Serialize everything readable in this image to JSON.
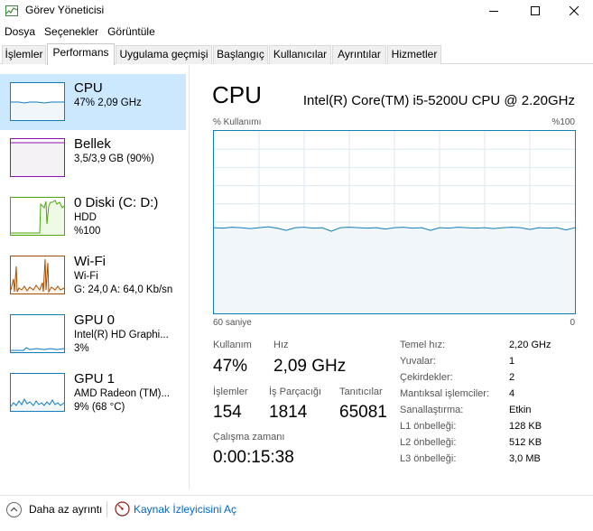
{
  "window": {
    "title": "Görev Yöneticisi",
    "minimize_icon": "minimize-icon",
    "maximize_icon": "maximize-icon",
    "close_icon": "close-icon"
  },
  "menu": [
    "Dosya",
    "Seçenekler",
    "Görüntüle"
  ],
  "tabs": [
    "İşlemler",
    "Performans",
    "Uygulama geçmişi",
    "Başlangıç",
    "Kullanıcılar",
    "Ayrıntılar",
    "Hizmetler"
  ],
  "active_tab": "Performans",
  "sidebar": [
    {
      "title": "CPU",
      "line2": "47% 2,09 GHz",
      "line3": "",
      "selected": true,
      "color": "#117dbb"
    },
    {
      "title": "Bellek",
      "line2": "3,5/3,9 GB (90%)",
      "line3": "",
      "selected": false,
      "color": "#8b12ae"
    },
    {
      "title": "0 Diski (C: D:)",
      "line2": "HDD",
      "line3": "%100",
      "selected": false,
      "color": "#4da60c"
    },
    {
      "title": "Wi-Fi",
      "line2": "Wi-Fi",
      "line3": "G: 24,0  A: 64,0 Kb/sn",
      "selected": false,
      "color": "#a74f01"
    },
    {
      "title": "GPU 0",
      "line2": "Intel(R) HD Graphi...",
      "line3": "3%",
      "selected": false,
      "color": "#117dbb"
    },
    {
      "title": "GPU 1",
      "line2": "AMD Radeon (TM)...",
      "line3": "9% (68 °C)",
      "selected": false,
      "color": "#117dbb"
    }
  ],
  "main": {
    "title": "CPU",
    "model": "Intel(R) Core(TM) i5-5200U CPU @ 2.20GHz",
    "graph_top_left": "% Kullanımı",
    "graph_top_right": "%100",
    "graph_bottom_left": "60 saniye",
    "graph_bottom_right": "0",
    "utilization_percent": 47,
    "stats": {
      "usage_label": "Kullanım",
      "usage_value": "47%",
      "speed_label": "Hız",
      "speed_value": "2,09 GHz",
      "processes_label": "İşlemler",
      "processes_value": "154",
      "threads_label": "İş Parçacığı",
      "threads_value": "1814",
      "handles_label": "Tanıtıcılar",
      "handles_value": "65081",
      "uptime_label": "Çalışma zamanı",
      "uptime_value": "0:00:15:38"
    },
    "specs": [
      {
        "label": "Temel hız:",
        "value": "2,20 GHz"
      },
      {
        "label": "Yuvalar:",
        "value": "1"
      },
      {
        "label": "Çekirdekler:",
        "value": "2"
      },
      {
        "label": "Mantıksal işlemciler:",
        "value": "4"
      },
      {
        "label": "Sanallaştırma:",
        "value": "Etkin"
      },
      {
        "label": "L1 önbelleği:",
        "value": "128 KB"
      },
      {
        "label": "L2 önbelleği:",
        "value": "512 KB"
      },
      {
        "label": "L3 önbelleği:",
        "value": "3,0 MB"
      }
    ]
  },
  "footer": {
    "fewer_details": "Daha az ayrıntı",
    "resource_monitor": "Kaynak İzleyicisini Aç"
  }
}
